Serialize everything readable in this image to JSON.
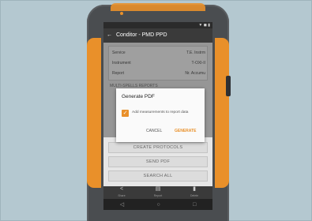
{
  "status_bar": {
    "icons": "▼ ◼ ▮"
  },
  "app_bar": {
    "back_icon": "back-arrow-icon",
    "title": "Conditor - PMD PPD"
  },
  "summary_rows": [
    {
      "label": "Service",
      "value": "T.E. Instrm"
    },
    {
      "label": "Instrument",
      "value": "T-OXI-II"
    },
    {
      "label": "Report",
      "value": "Nr. Accumu"
    }
  ],
  "section_header": "MULTI-SPELLS REPORTS",
  "dialog": {
    "title": "Generate PDF",
    "checkbox_checked": true,
    "checkbox_label": "Add measurements to report data",
    "cancel_label": "CANCEL",
    "ok_label": "GENERATE"
  },
  "buttons": [
    "CREATE PROTOCOLS",
    "SEND PDF",
    "SEARCH ALL"
  ],
  "bottom_actions": [
    {
      "icon": "share-icon",
      "glyph": "<",
      "label": "Share"
    },
    {
      "icon": "document-icon",
      "glyph": "▤",
      "label": "Report"
    },
    {
      "icon": "delete-icon",
      "glyph": "▮",
      "label": "Delete"
    }
  ],
  "nav_bar": {
    "back": "◁",
    "home": "○",
    "recent": "□"
  },
  "colors": {
    "accent": "#e9902a",
    "device": "#4a4d50",
    "background": "#b4c8d0"
  }
}
